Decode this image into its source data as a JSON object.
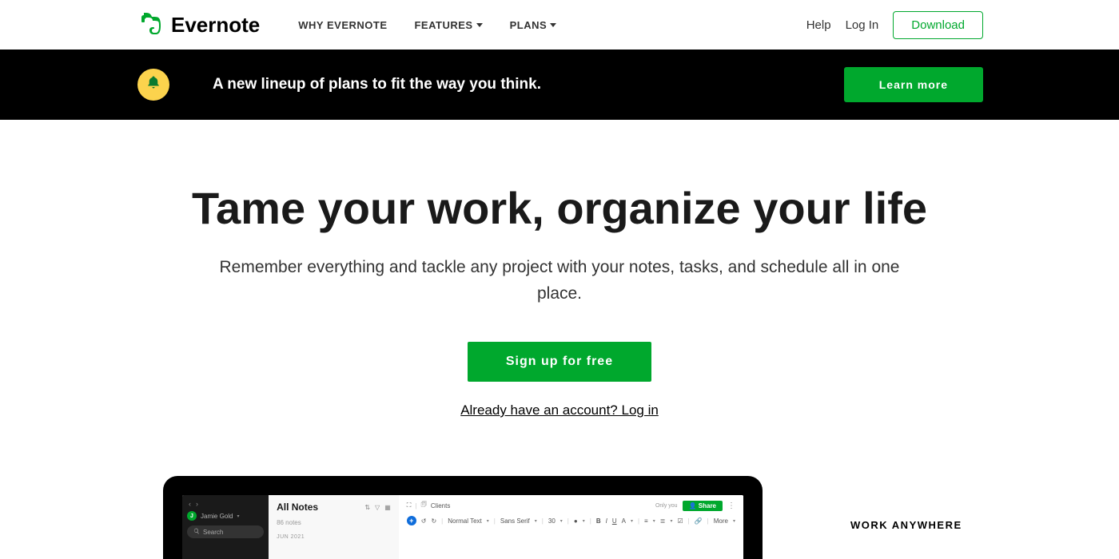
{
  "nav": {
    "brand": "Evernote",
    "links": [
      {
        "label": "WHY EVERNOTE",
        "dropdown": false
      },
      {
        "label": "FEATURES",
        "dropdown": true
      },
      {
        "label": "PLANS",
        "dropdown": true
      }
    ],
    "help": "Help",
    "login": "Log In",
    "download": "Download"
  },
  "banner": {
    "text": "A new lineup of plans to fit the way you think.",
    "cta": "Learn more"
  },
  "hero": {
    "title": "Tame your work, organize your life",
    "subtitle": "Remember everything and tackle any project with your notes, tasks, and schedule all in one place.",
    "signup": "Sign up for free",
    "login_link": "Already have an account? Log in"
  },
  "mock": {
    "user": "Jamie Gold",
    "search": "Search",
    "list_title": "All Notes",
    "list_count": "86 notes",
    "list_date": "JUN 2021",
    "breadcrumb": "Clients",
    "only_you": "Only you",
    "share": "Share",
    "toolbar": {
      "style": "Normal Text",
      "font": "Sans Serif",
      "size": "30",
      "more": "More"
    }
  },
  "side_heading": "WORK ANYWHERE"
}
